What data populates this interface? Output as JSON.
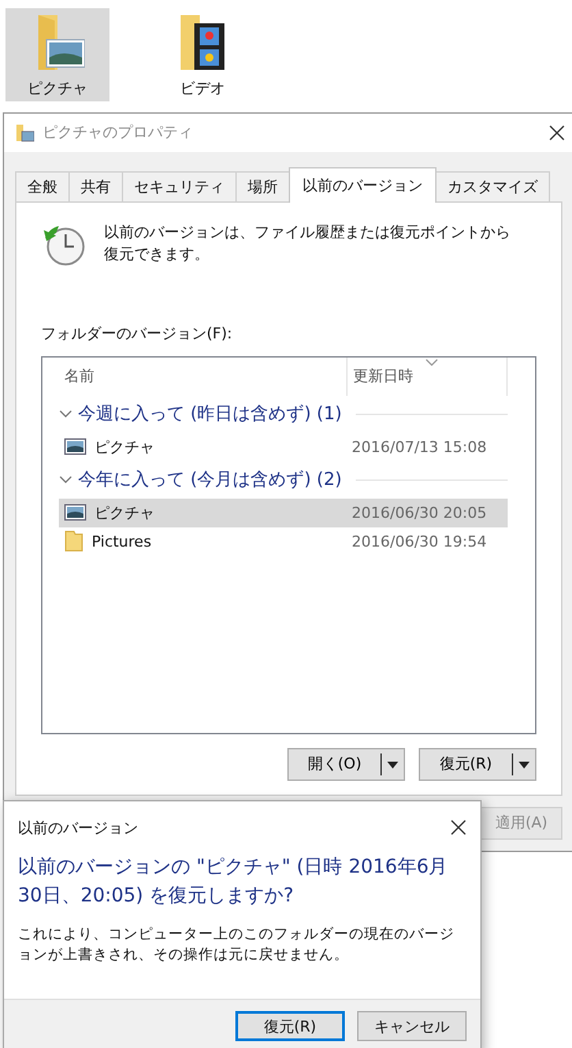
{
  "desktop_icons": [
    {
      "label": "ピクチャ",
      "kind": "pictures",
      "selected": true
    },
    {
      "label": "ビデオ",
      "kind": "videos",
      "selected": false
    }
  ],
  "properties_window": {
    "title": "ピクチャのプロパティ",
    "tabs": [
      {
        "label": "全般",
        "selected": false
      },
      {
        "label": "共有",
        "selected": false
      },
      {
        "label": "セキュリティ",
        "selected": false
      },
      {
        "label": "場所",
        "selected": false
      },
      {
        "label": "以前のバージョン",
        "selected": true
      },
      {
        "label": "カスタマイズ",
        "selected": false
      }
    ],
    "description": "以前のバージョンは、ファイル履歴または復元ポイントから復元できます。",
    "list_label": "フォルダーのバージョン(F):",
    "columns": [
      "名前",
      "更新日時"
    ],
    "groups": [
      {
        "label": "今週に入って (昨日は含めず) (1)",
        "expanded": true,
        "children": [
          {
            "name": "ピクチャ",
            "kind": "pictures",
            "date": "2016/07/13 15:08",
            "selected": false
          }
        ]
      },
      {
        "label": "今年に入って (今月は含めず) (2)",
        "expanded": true,
        "children": [
          {
            "name": "ピクチャ",
            "kind": "pictures",
            "date": "2016/06/30 20:05",
            "selected": true
          },
          {
            "name": "Pictures",
            "kind": "folder",
            "date": "2016/06/30 19:54",
            "selected": false
          }
        ]
      }
    ],
    "split_buttons": [
      "開く(O)",
      "復元(R)"
    ],
    "footer_buttons": [
      {
        "label": "適用(A)",
        "disabled": true
      }
    ]
  },
  "confirm_dialog": {
    "title": "以前のバージョン",
    "question": "以前のバージョンの \"ピクチャ\" (日時 2016年6月30日、20:05) を復元しますか?",
    "message": "これにより、コンピューター上のこのフォルダーの現在のバージョンが上書きされ、その操作は元に戻せません。",
    "buttons": [
      {
        "label": "復元(R)",
        "focused": true
      },
      {
        "label": "キャンセル",
        "focused": false
      }
    ]
  }
}
